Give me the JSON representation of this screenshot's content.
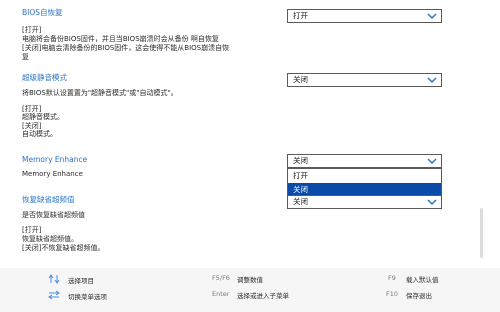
{
  "sections": {
    "bios_recovery": {
      "title": "BIOS自恢复",
      "selected": "打开",
      "help": [
        "[打开]",
        "电脑将会备份BIOS固件，并且当BIOS崩溃时会从备份 啊自恢复",
        "[关闭]电脑会清除备份的BIOS固件，这会使得不能从BIOS崩溃自恢",
        "复"
      ]
    },
    "super_silent": {
      "title": "超级静音模式",
      "selected": "关闭",
      "help": [
        "将BIOS默认设置置为\"超静音模式\"或\"自动模式\"。",
        "[打开]",
        " 超静音模式。",
        "[关闭]",
        " 自动模式。"
      ]
    },
    "memory_enhance": {
      "title": "Memory Enhance",
      "desc": "Memory Enhance",
      "selected": "关闭",
      "options": [
        "打开",
        "关闭"
      ],
      "highlighted": "关闭"
    },
    "restore_defaults": {
      "title": "恢复缺省超频值",
      "selected": "关闭",
      "help": [
        "是否恢复缺省超频值",
        "[打开]",
        "恢复缺省超频值。",
        "[关闭]不恢复缺省超频值。"
      ]
    }
  },
  "footer": {
    "select_item": "选择项目",
    "switch_menu": "切换菜单选项",
    "f5f6_key": "F5/F6",
    "f5f6_label": "调整数值",
    "enter_key": "Enter",
    "enter_label": "选择或进入子菜单",
    "f9_key": "F9",
    "f9_label": "载入默认值",
    "f10_key": "F10",
    "f10_label": "保存退出"
  },
  "colors": {
    "accent": "#2a73c8",
    "highlight": "#0a4aa8"
  }
}
